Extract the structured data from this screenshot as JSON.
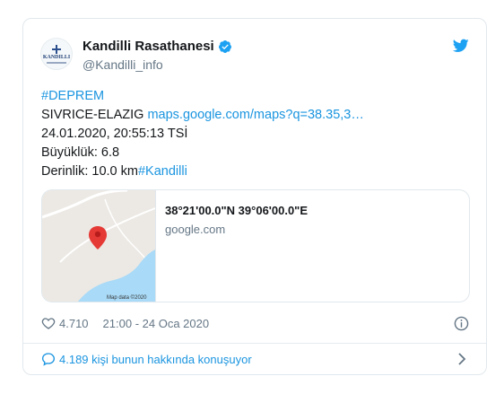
{
  "tweet": {
    "author_name": "Kandilli Rasathanesi",
    "author_handle": "@Kandilli_info",
    "avatar_text": "KANDILLI",
    "lines": {
      "hashtag1": "#DEPREM",
      "location": "SIVRICE-ELAZIG",
      "maps_link": "maps.google.com/maps?q=38.35,3…",
      "datetime": "24.01.2020, 20:55:13 TSİ",
      "magnitude": "Büyüklük: 6.8",
      "depth": "Derinlik: 10.0 km",
      "hashtag2": "#Kandilli"
    },
    "link_card": {
      "title": "38°21'00.0\"N 39°06'00.0\"E",
      "domain": "google.com",
      "map_credit": "Map data ©2020"
    },
    "likes": "4.710",
    "timestamp": "21:00 - 24 Oca 2020",
    "conversation": "4.189 kişi bunun hakkında konuşuyor"
  },
  "colors": {
    "link": "#1b95e0",
    "muted": "#657786",
    "pin": "#e53935",
    "water": "#a9daf7"
  },
  "icons": [
    "verified-badge-icon",
    "twitter-bird-icon",
    "heart-icon",
    "info-icon",
    "reply-bubble-icon",
    "chevron-right-icon",
    "map-pin-icon"
  ]
}
